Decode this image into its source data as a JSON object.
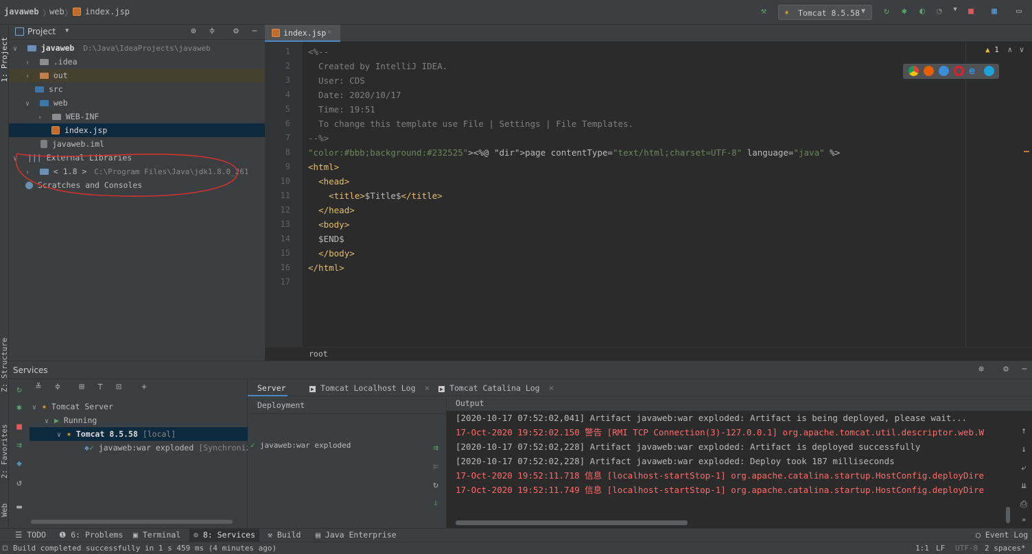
{
  "breadcrumb": {
    "project": "javaweb",
    "folder": "web",
    "file": "index.jsp"
  },
  "runconfig": {
    "label": "Tomcat 8.5.58"
  },
  "project_panel": {
    "title": "Project",
    "items": [
      {
        "label": "javaweb",
        "path": "D:\\Java\\IdeaProjects\\javaweb"
      },
      {
        "label": ".idea"
      },
      {
        "label": "out"
      },
      {
        "label": "src"
      },
      {
        "label": "web"
      },
      {
        "label": "WEB-INF"
      },
      {
        "label": "index.jsp"
      },
      {
        "label": "javaweb.iml"
      },
      {
        "label": "External Libraries"
      },
      {
        "label": "< 1.8 >",
        "path": "C:\\Program Files\\Java\\jdk1.8.0_261"
      },
      {
        "label": "Scratches and Consoles"
      }
    ]
  },
  "left_strip": {
    "project": "1: Project",
    "structure": "Z: Structure",
    "favorites": "2: Favorites",
    "web": "Web"
  },
  "editor": {
    "tab": "index.jsp",
    "warnings": "1",
    "lines": [
      "<%--",
      "  Created by IntelliJ IDEA.",
      "  User: CDS",
      "  Date: 2020/10/17",
      "  Time: 19:51",
      "  To change this template use File | Settings | File Templates.",
      "--%>",
      "<%@ page contentType=\"text/html;charset=UTF-8\" language=\"java\" %>",
      "<html>",
      "  <head>",
      "    <title>$Title$</title>",
      "  </head>",
      "  <body>",
      "  $END$",
      "  </body>",
      "</html>",
      ""
    ],
    "breadcrumb": "root"
  },
  "services": {
    "title": "Services",
    "tree": [
      {
        "label": "Tomcat Server"
      },
      {
        "label": "Running"
      },
      {
        "label": "Tomcat 8.5.58",
        "note": "[local]"
      },
      {
        "label": "javaweb:war exploded",
        "note": "[Synchroniz"
      }
    ],
    "tabs": [
      "Server",
      "Tomcat Localhost Log",
      "Tomcat Catalina Log"
    ],
    "deployment_header": "Deployment",
    "deployment_item": "javaweb:war exploded",
    "output_header": "Output",
    "output_lines": [
      {
        "text": "[2020-10-17 07:52:02,041] Artifact javaweb:war exploded: Artifact is being deployed, please wait...",
        "level": "info"
      },
      {
        "text": "17-Oct-2020 19:52:02.150 警告 [RMI TCP Connection(3)-127.0.0.1] org.apache.tomcat.util.descriptor.web.W",
        "level": "error"
      },
      {
        "text": "[2020-10-17 07:52:02,228] Artifact javaweb:war exploded: Artifact is deployed successfully",
        "level": "info"
      },
      {
        "text": "[2020-10-17 07:52:02,228] Artifact javaweb:war exploded: Deploy took 187 milliseconds",
        "level": "info"
      },
      {
        "text": "17-Oct-2020 19:52:11.718 信息 [localhost-startStop-1] org.apache.catalina.startup.HostConfig.deployDire",
        "level": "error"
      },
      {
        "text": "17-Oct-2020 19:52:11.749 信息 [localhost-startStop-1] org.apache.catalina.startup.HostConfig.deployDire",
        "level": "error"
      }
    ]
  },
  "bottom_tabs": {
    "todo": "TODO",
    "problems": "6: Problems",
    "terminal": "Terminal",
    "services": "8: Services",
    "build": "Build",
    "java_enterprise": "Java Enterprise",
    "event_log": "Event Log"
  },
  "status": {
    "message": "Build completed successfully in 1 s 459 ms (4 minutes ago)",
    "position": "1:1",
    "line_sep": "LF",
    "encoding": "UTF-8",
    "indent": "2 spaces*"
  }
}
